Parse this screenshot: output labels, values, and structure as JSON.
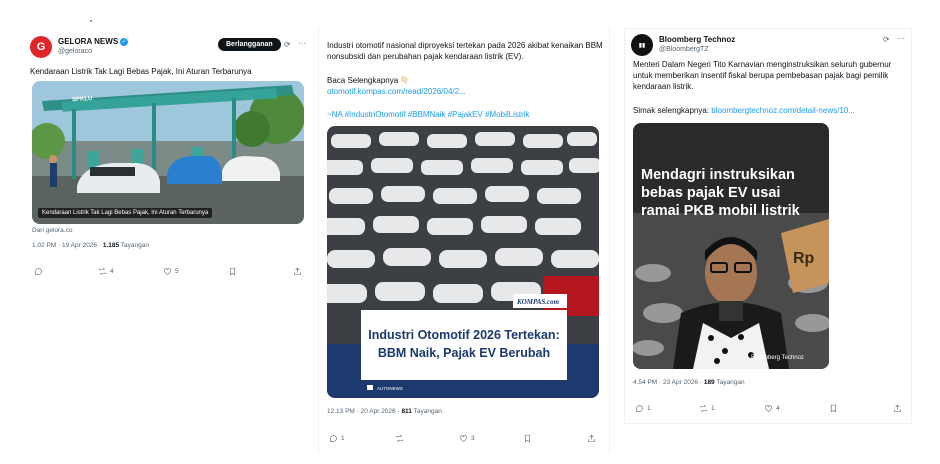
{
  "posts": [
    {
      "display_name": "GELORA NEWS",
      "handle": "@geloraco",
      "subscribe_label": "Berlangganan",
      "text": "Kendaraan Listrik Tak Lagi Bebas Pajak, Ini Aturan Terbarunya",
      "image_caption": "Kendaraan Listrik Tak Lagi Bebas Pajak, Ini Aturan Terbarunya",
      "image_sign": "SPKLU",
      "source": "Dari gelora.co",
      "time": "1.02 PM · 19 Apr 2026 · ",
      "views": "1.185",
      "views_label": " Tayangan",
      "replies": "",
      "reposts": "4",
      "likes": "5",
      "brand_color": "#e0262b"
    },
    {
      "text": "Industri otomotif nasional diproyeksi tertekan pada 2026 akibat kenaikan BBM nonsubsidi dan perubahan pajak kendaraan listrik (EV).",
      "read_more": "Baca Selengkapnya 👇🏻",
      "link": "otomotif.kompas.com/read/2026/04/2...",
      "hashtags": "~NA #IndustriOtomotif #BBMNaik #PajakEV #MobilListrik",
      "image_logo": "KOMPAS.com",
      "image_headline_1": "Industri Otomotif 2026 Tertekan:",
      "image_headline_2": "BBM Naik, Pajak EV Berubah",
      "image_source": "AUTONEWS",
      "time": "12.13 PM · 20 Apr 2026 · ",
      "views": "811",
      "views_label": " Tayangan",
      "replies": "1",
      "reposts": "",
      "likes": "3"
    },
    {
      "display_name": "Bloomberg Technoz",
      "handle": "@BloombergTZ",
      "text": "Menteri Dalam Negeri Tito Karnavian menginstruksikan seluruh gubernur untuk memberikan insentif fiskal berupa pembebasan pajak bagi pemilik kendaraan listrik.",
      "read_more_prefix": "Simak selengkapnya: ",
      "link": "bloombergtechnoz.com/detail-news/10...",
      "image_headline": "Mendagri instruksikan bebas pajak EV usai ramai PKB mobil listrik",
      "image_watermark": "Bloomberg Technoz",
      "image_sign": "Rp",
      "time": "4.54 PM · 23 Apr 2026 · ",
      "views": "189",
      "views_label": " Tayangan",
      "replies": "1",
      "reposts": "1",
      "likes": "4"
    }
  ]
}
